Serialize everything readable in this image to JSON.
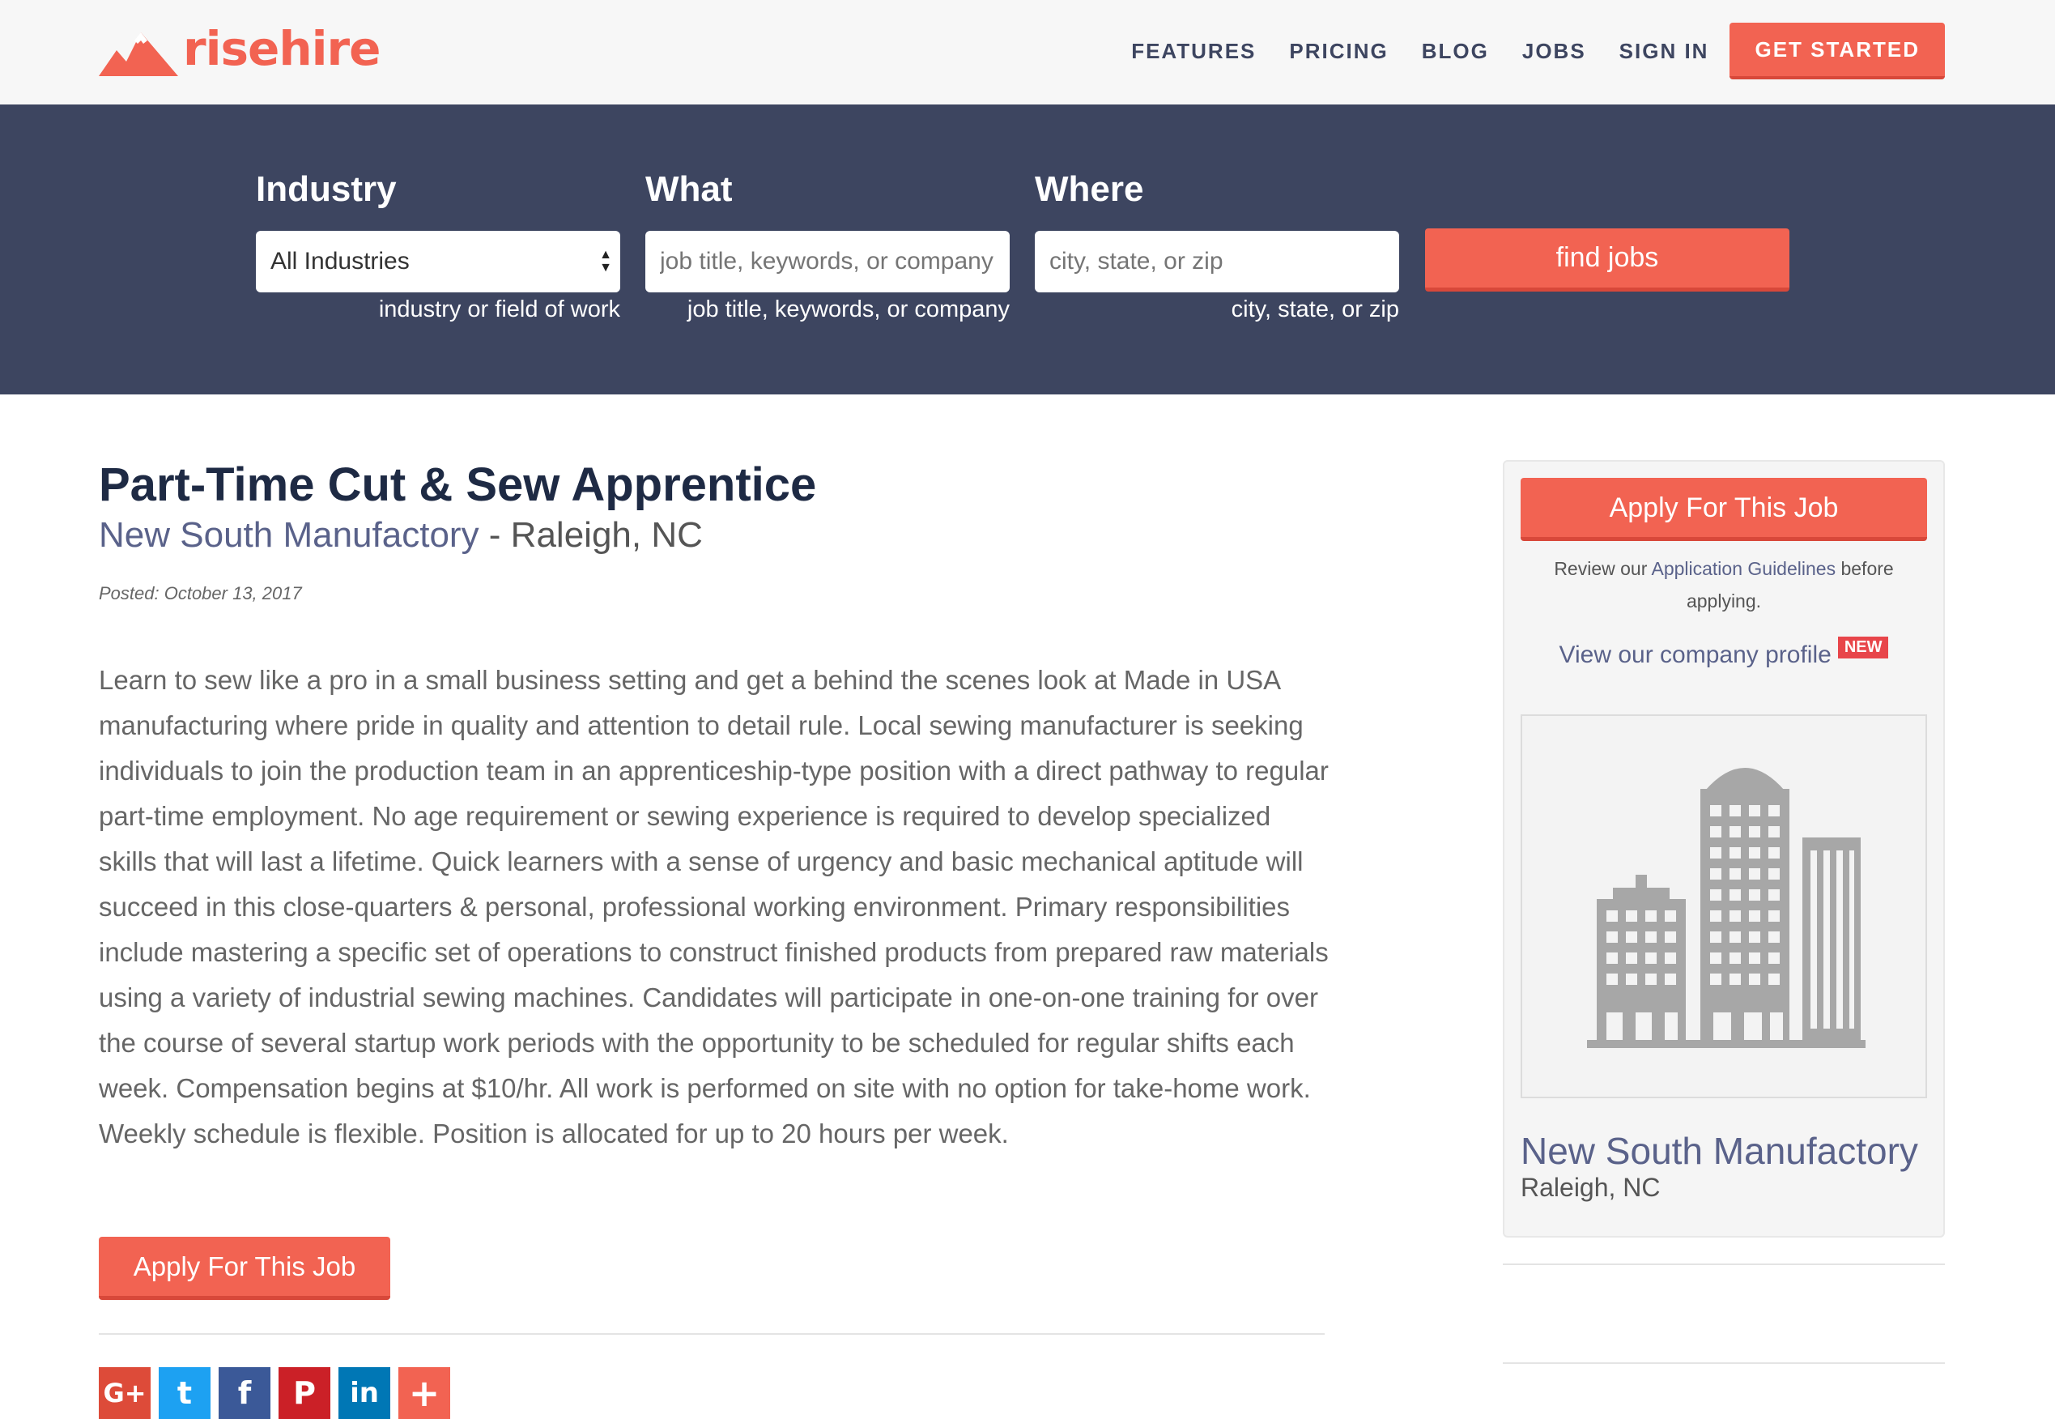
{
  "brand": {
    "name": "risehire",
    "color": "#f26352"
  },
  "nav": {
    "items": [
      "FEATURES",
      "PRICING",
      "BLOG",
      "JOBS",
      "SIGN IN"
    ],
    "cta": "GET STARTED"
  },
  "search": {
    "industry": {
      "label": "Industry",
      "value": "All Industries",
      "hint": "industry or field of work"
    },
    "what": {
      "label": "What",
      "placeholder": "job title, keywords, or company",
      "hint": "job title, keywords, or company"
    },
    "where": {
      "label": "Where",
      "placeholder": "city, state, or zip",
      "hint": "city, state, or zip"
    },
    "button": "find jobs"
  },
  "job": {
    "title": "Part-Time Cut & Sew Apprentice",
    "company": "New South Manufactory",
    "separator": " - ",
    "location": "Raleigh, NC",
    "posted": "Posted: October 13, 2017",
    "description": "Learn to sew like a pro in a small business setting and get a behind the scenes look at Made in USA manufacturing where pride in quality and attention to detail rule. Local sewing manufacturer is seeking individuals to join the production team in an apprenticeship-type position with a direct pathway to regular part-time employment. No age requirement or sewing experience is required to develop specialized skills that will last a lifetime. Quick learners with a sense of urgency and basic mechanical aptitude will succeed in this close-quarters & personal, professional working environment. Primary responsibilities include mastering a specific set of operations to construct finished products from prepared raw materials using a variety of industrial sewing machines. Candidates will participate in one-on-one training for over the course of several startup work periods with the opportunity to be scheduled for regular shifts each week. Compensation begins at $10/hr. All work is performed on site with no option for take-home work. Weekly schedule is flexible. Position is allocated for up to 20 hours per week.",
    "apply_label": "Apply For This Job"
  },
  "social": [
    {
      "icon": "google-plus-icon",
      "glyph": "G+",
      "color": "#dd4b39"
    },
    {
      "icon": "twitter-icon",
      "glyph": "t",
      "color": "#1da1f2"
    },
    {
      "icon": "facebook-icon",
      "glyph": "f",
      "color": "#3b5998"
    },
    {
      "icon": "pinterest-icon",
      "glyph": "P",
      "color": "#cb2027"
    },
    {
      "icon": "linkedin-icon",
      "glyph": "in",
      "color": "#0077b5"
    },
    {
      "icon": "share-plus-icon",
      "glyph": "+",
      "color": "#f26352"
    }
  ],
  "sidebar": {
    "apply_label": "Apply For This Job",
    "review_prefix": "Review our ",
    "review_link": "Application Guidelines",
    "review_suffix": " before applying.",
    "profile_link": "View our company profile",
    "new_badge": "NEW",
    "company_name": "New South Manufactory",
    "company_location": "Raleigh, NC"
  }
}
